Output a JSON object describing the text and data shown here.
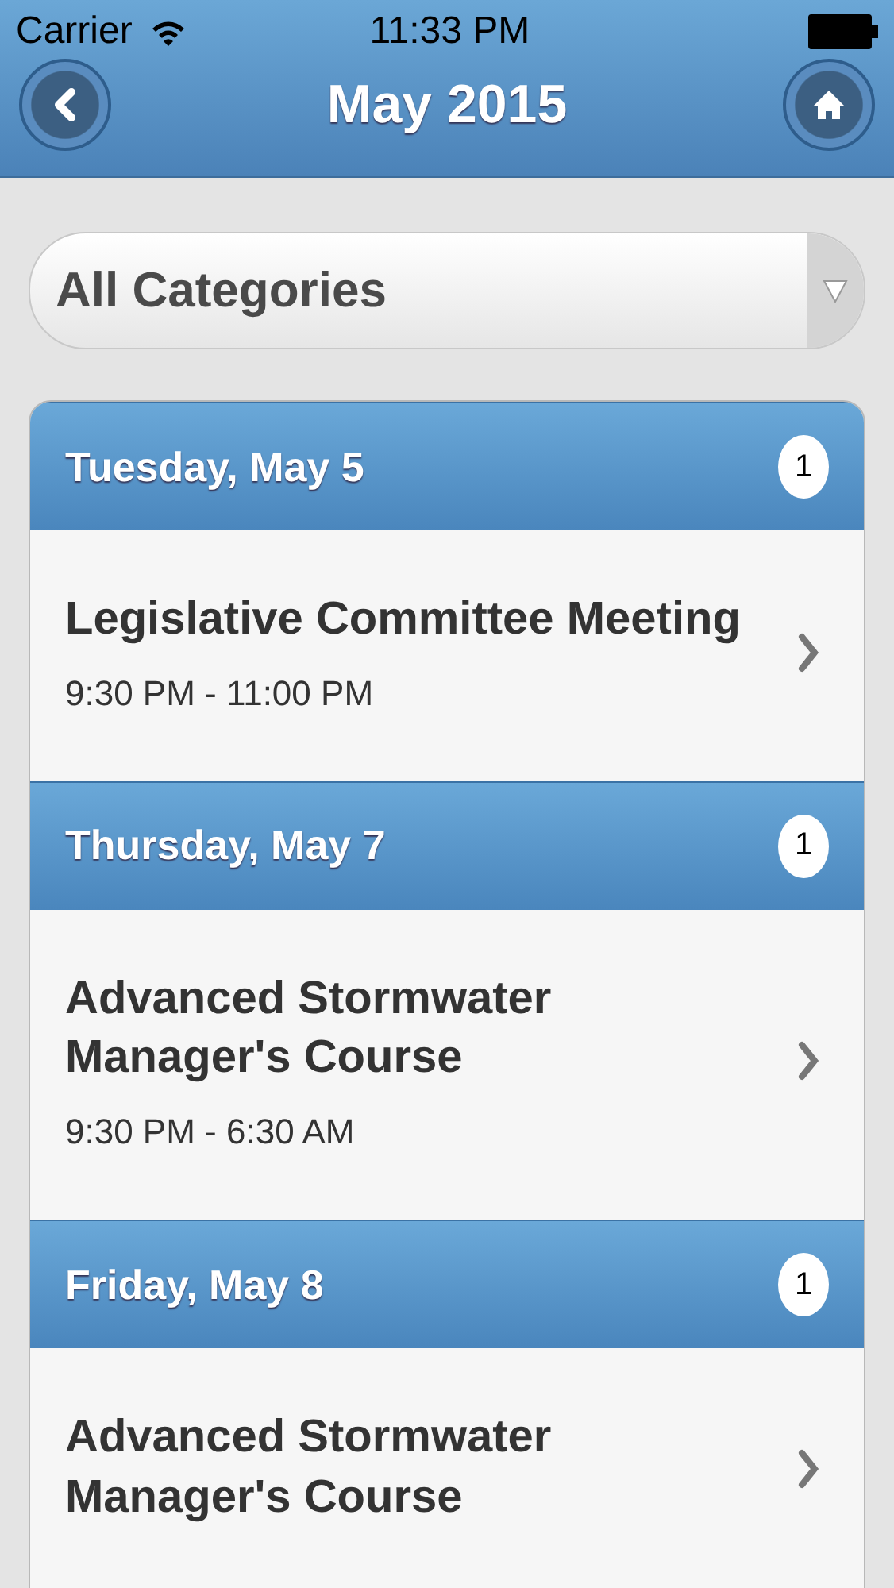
{
  "status_bar": {
    "carrier": "Carrier",
    "time": "11:33 PM"
  },
  "header": {
    "title": "May 2015"
  },
  "filter": {
    "value": "All Categories"
  },
  "days": [
    {
      "label": "Tuesday, May 5",
      "count": "1",
      "events": [
        {
          "title": "Legislative Committee Meeting",
          "time": "9:30 PM - 11:00 PM"
        }
      ]
    },
    {
      "label": "Thursday, May 7",
      "count": "1",
      "events": [
        {
          "title": "Advanced Stormwater Manager's Course",
          "time": "9:30 PM - 6:30 AM"
        }
      ]
    },
    {
      "label": "Friday, May 8",
      "count": "1",
      "events": [
        {
          "title": "Advanced Stormwater Manager's Course"
        }
      ]
    }
  ]
}
